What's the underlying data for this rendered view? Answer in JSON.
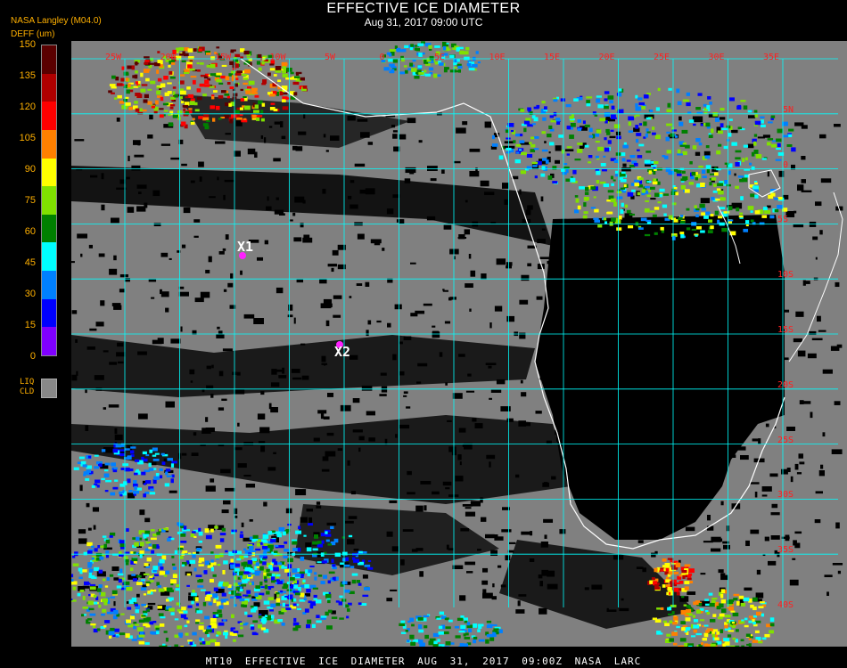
{
  "header": {
    "title": "EFFECTIVE ICE DIAMETER",
    "subtitle": "Aug 31, 2017 09:00 UTC",
    "org": "NASA Langley (M04.0)",
    "units": "DEFF (um)"
  },
  "legend": {
    "labels": [
      "150",
      "135",
      "120",
      "105",
      "90",
      "75",
      "60",
      "45",
      "30",
      "15",
      "0"
    ],
    "colors": [
      "#5a0000",
      "#b00000",
      "#ff0000",
      "#ff8000",
      "#ffff00",
      "#80e000",
      "#008000",
      "#00ffff",
      "#0080ff",
      "#0000ff",
      "#8000ff"
    ],
    "liq_label_top": "LIQ",
    "liq_label_bottom": "CLD",
    "liq_color": "#888888"
  },
  "grid": {
    "lon_labels": [
      "25W",
      "20W",
      "15W",
      "10W",
      "5W",
      "0",
      "5E",
      "10E",
      "15E",
      "20E",
      "25E",
      "30E",
      "35E"
    ],
    "lat_labels": [
      "5N",
      "0",
      "5S",
      "10S",
      "15S",
      "20S",
      "25S",
      "30S",
      "35S",
      "40S"
    ],
    "line_color": "#00ffff",
    "label_color": "#ff2020"
  },
  "markers": [
    {
      "label": "X1"
    },
    {
      "label": "X2"
    }
  ],
  "colors": {
    "background": "#000000",
    "cloud_liquid": "#808080",
    "clear": "#000000",
    "coast": "#ffffff"
  },
  "footer": "MT10 EFFECTIVE ICE DIAMETER AUG 31, 2017 09:00Z NASA LARC"
}
